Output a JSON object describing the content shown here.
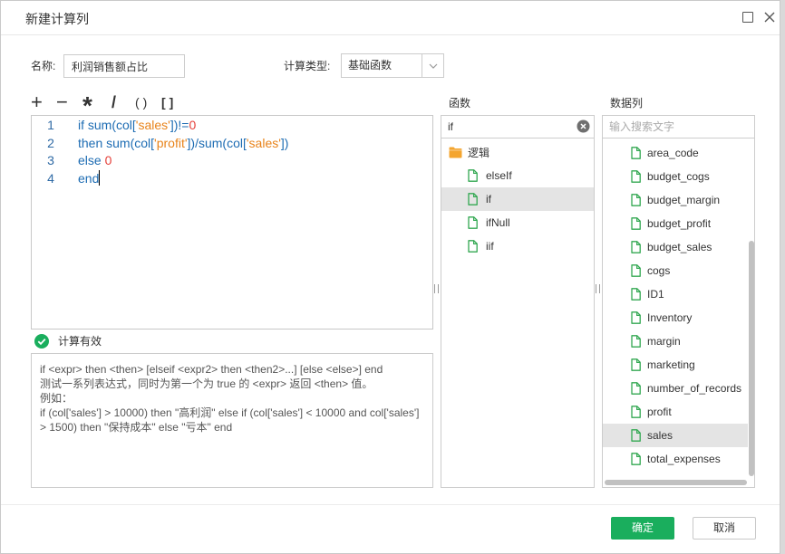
{
  "dialog": {
    "title": "新建计算列",
    "icons": {
      "maximize": "maximize-icon",
      "close": "close-icon"
    }
  },
  "form": {
    "name_label": "名称:",
    "name_value": "利润销售额占比",
    "type_label": "计算类型:",
    "type_value": "基础函数"
  },
  "operators": [
    "+",
    "−",
    "*",
    "/",
    "()",
    "[]"
  ],
  "editor": {
    "line_numbers": [
      "1",
      "2",
      "3",
      "4"
    ],
    "lines": [
      [
        "if sum(col[",
        "'sales'",
        "])!=",
        "0"
      ],
      [
        "then sum(col[",
        "'profit'",
        "])/sum(col[",
        "'sales'",
        "])"
      ],
      [
        "else ",
        "0"
      ],
      [
        "end"
      ]
    ]
  },
  "status": {
    "icon": "check-circle-icon",
    "text": "计算有效"
  },
  "help": {
    "lines": [
      "if <expr> then <then> [elseif <expr2> then <then2>...] [else <else>] end",
      "测试一系列表达式，同时为第一个为 true 的 <expr> 返回 <then> 值。",
      "例如：",
      "if (col['sales'] > 10000) then \"高利润\" else if (col['sales'] < 10000 and col['sales'] > 1500) then \"保持成本\" else \"亏本\" end"
    ]
  },
  "functions": {
    "label": "函数",
    "search_value": "if",
    "group": "逻辑",
    "group_icon": "folder-icon",
    "item_icon": "file-icon",
    "items": [
      "elseIf",
      "if",
      "ifNull",
      "iif"
    ],
    "selected_index": 1
  },
  "columns": {
    "label": "数据列",
    "search_placeholder": "输入搜索文字",
    "item_icon": "file-icon",
    "items": [
      "area_code",
      "budget_cogs",
      "budget_margin",
      "budget_profit",
      "budget_sales",
      "cogs",
      "ID1",
      "Inventory",
      "margin",
      "marketing",
      "number_of_records",
      "profit",
      "sales",
      "total_expenses"
    ],
    "selected_index": 12
  },
  "footer": {
    "ok_label": "确定",
    "cancel_label": "取消"
  },
  "colors": {
    "accent": "#1aae5d",
    "selection": "#e4e4e4",
    "code": "#1d6cb3",
    "string": "#e8831a",
    "number": "#e5403a",
    "file-icon": "#33a852",
    "folder-icon": "#f4a52f"
  }
}
